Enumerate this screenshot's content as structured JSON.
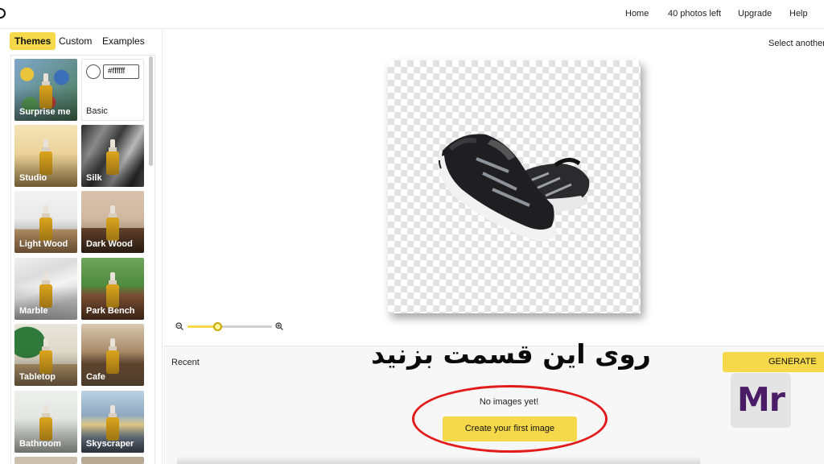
{
  "nav": {
    "home": "Home",
    "photos_left": "40 photos left",
    "upgrade": "Upgrade",
    "help": "Help"
  },
  "sidebar": {
    "tabs": [
      "Themes",
      "Custom",
      "Examples"
    ],
    "active_tab": "Themes",
    "basic": {
      "hex_value": "#ffffff",
      "label": "Basic"
    },
    "themes": [
      {
        "label": "Surprise me",
        "selected": true
      },
      {
        "label": "Studio"
      },
      {
        "label": "Silk"
      },
      {
        "label": "Light Wood"
      },
      {
        "label": "Dark Wood"
      },
      {
        "label": "Marble"
      },
      {
        "label": "Park Bench"
      },
      {
        "label": "Tabletop"
      },
      {
        "label": "Cafe"
      },
      {
        "label": "Bathroom"
      },
      {
        "label": "Skyscraper"
      }
    ]
  },
  "canvas": {
    "select_another": "Select another p",
    "zoom_level": 0.35
  },
  "recent": {
    "title": "Recent",
    "empty_text": "No images yet!",
    "create_button": "Create your first image"
  },
  "generate_label": "GENERATE",
  "overlay": {
    "persian_text": "روی این قسمت بزنید",
    "watermark": "Mr"
  },
  "colors": {
    "accent": "#f5d94a",
    "annotation_ring": "#e21b1b",
    "watermark": "#4b1c66"
  }
}
